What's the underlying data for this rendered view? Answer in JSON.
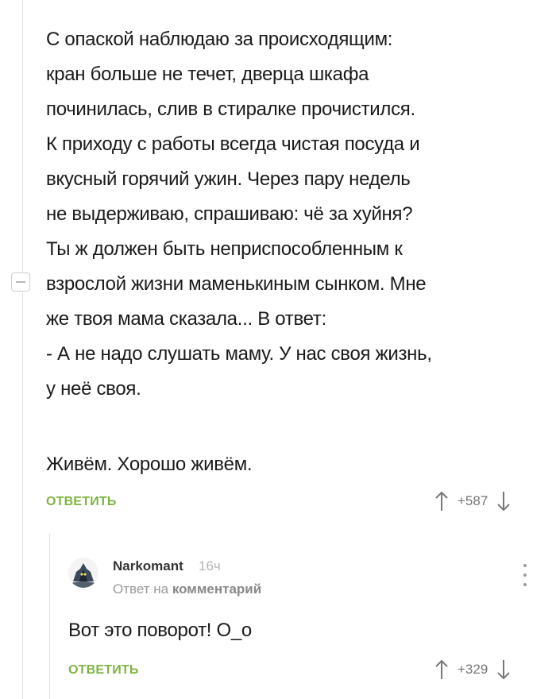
{
  "comment": {
    "lines": [
      "С опаской наблюдаю за происходящим:",
      "кран больше не течет, дверца шкафа",
      "починилась, слив в стиралке прочистился.",
      "К приходу с работы всегда чистая посуда и",
      "вкусный горячий ужин. Через пару недель",
      "не выдерживаю, спрашиваю: чё за хуйня?",
      "Ты ж должен быть неприспособленным к",
      "взрослой жизни маменькиным сынком. Мне",
      "же твоя мама сказала... В ответ:",
      "- А не надо слушать маму. У нас своя жизнь,",
      "у неё своя."
    ],
    "closing": "Живём. Хорошо живём.",
    "reply_label": "ОТВЕТИТЬ",
    "rating": "+587"
  },
  "reply": {
    "author": "Narkomant",
    "time": "16ч",
    "reply_note_prefix": "Ответ на",
    "reply_note_link": "комментарий",
    "text": "Вот это поворот! О_о",
    "reply_label": "ОТВЕТИТЬ",
    "rating": "+329"
  },
  "colors": {
    "accent": "#7fb543",
    "muted": "#999999"
  },
  "icons": [
    "collapse-icon",
    "upvote-icon",
    "downvote-icon",
    "avatar-image",
    "more-options-icon"
  ]
}
